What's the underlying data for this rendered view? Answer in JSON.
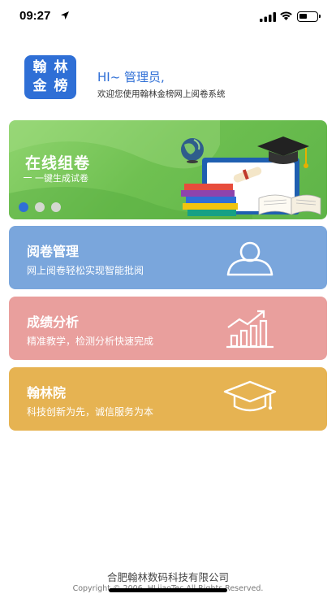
{
  "status_bar": {
    "time": "09:27"
  },
  "header": {
    "logo_chars": [
      "翰",
      "林",
      "金",
      "榜"
    ],
    "greeting": "HI~ 管理员,",
    "welcome": "欢迎您使用翰林金榜网上阅卷系统"
  },
  "banner": {
    "title": "在线组卷",
    "subtitle": "一键生成试卷",
    "slide_count": 3,
    "active_slide": 1
  },
  "cards": {
    "review": {
      "title": "阅卷管理",
      "desc": "网上阅卷轻松实现智能批阅",
      "icon": "user-icon",
      "color": "#7aa6dc"
    },
    "score": {
      "title": "成绩分析",
      "desc": "精准教学，检测分析快速完成",
      "icon": "bar-chart-icon",
      "color": "#e99f9d"
    },
    "academy": {
      "title": "翰林院",
      "desc": "科技创新为先，诚信服务为本",
      "icon": "graduation-cap-icon",
      "color": "#e6b352"
    }
  },
  "footer": {
    "company": "合肥翰林数码科技有限公司",
    "copyright": "Copyright © 2006, HLjiaoTec All Rights Reserved."
  },
  "colors": {
    "brand": "#2f6fd6",
    "banner_green": "#6fc051"
  }
}
